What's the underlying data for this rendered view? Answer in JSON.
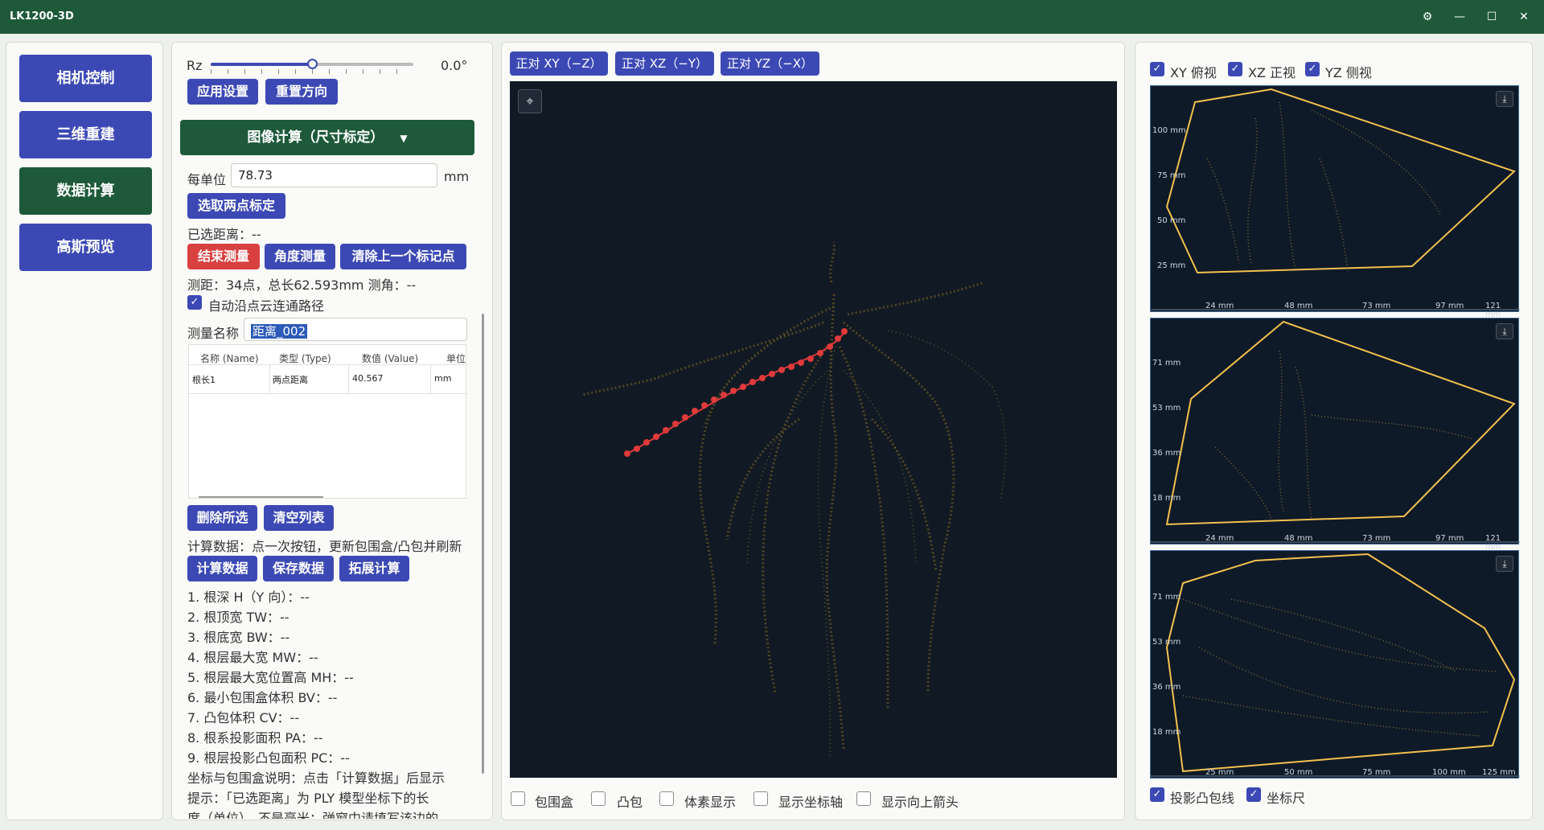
{
  "app_title": "LK1200-3D",
  "nav": [
    {
      "label": "相机控制"
    },
    {
      "label": "三维重建"
    },
    {
      "label": "数据计算"
    },
    {
      "label": "高斯预览"
    }
  ],
  "rotation": {
    "label": "Rz",
    "value": "0.0°",
    "apply_label": "应用设置",
    "reset_label": "重置方向"
  },
  "section_header": "图像计算（尺寸标定）",
  "unit": {
    "label": "每单位",
    "value": "78.73",
    "suffix": "mm"
  },
  "pick_two_points_label": "选取两点标定",
  "selected_distance": "已选距离：--",
  "measure_buttons": {
    "end": "结束测量",
    "angle": "角度测量",
    "clear_last": "清除上一个标记点"
  },
  "measure_status": "测距：34点，总长62.593mm 测角：--",
  "auto_path": {
    "label": "自动沿点云连通路径",
    "checked": true
  },
  "measure_name": {
    "label": "测量名称",
    "value": "距离_002"
  },
  "table": {
    "headers": [
      "名称 (Name)",
      "类型 (Type)",
      "数值 (Value)",
      "单位"
    ],
    "rows": [
      [
        "根长1",
        "两点距离",
        "40.567",
        "mm"
      ]
    ]
  },
  "list_buttons": {
    "delete": "删除所选",
    "clear": "清空列表"
  },
  "compute_hint": "计算数据：点一次按钮，更新包围盒/凸包并刷新",
  "compute_buttons": {
    "compute": "计算数据",
    "save": "保存数据",
    "extend": "拓展计算"
  },
  "results": [
    "1. 根深 H（Y 向）：--",
    "2. 根顶宽 TW：--",
    "3. 根底宽 BW：--",
    "4. 根层最大宽 MW：--",
    "5. 根层最大宽位置高 MH：--",
    "6. 最小包围盒体积 BV：--",
    "7. 凸包体积 CV：--",
    "8. 根系投影面积 PA：--",
    "9. 根层投影凸包面积 PC：--"
  ],
  "notes": [
    "坐标与包围盒说明：点击「计算数据」后显示",
    "提示：「已选距离」为 PLY 模型坐标下的长",
    "度（单位）。不是毫米；弹窗中请填写该边的"
  ],
  "view_buttons": [
    "正对 XY（−Z）",
    "正对 XZ（−Y）",
    "正对 YZ（−X）"
  ],
  "bottom_checks": [
    {
      "label": "包围盒",
      "checked": false
    },
    {
      "label": "凸包",
      "checked": false
    },
    {
      "label": "体素显示",
      "checked": false
    },
    {
      "label": "显示坐标轴",
      "checked": false
    },
    {
      "label": "显示向上箭头",
      "checked": false
    }
  ],
  "proj_checks": [
    {
      "label": "XY 俯视",
      "checked": true
    },
    {
      "label": "XZ 正视",
      "checked": true
    },
    {
      "label": "YZ 侧视",
      "checked": true
    }
  ],
  "proj_bottom_checks": [
    {
      "label": "投影凸包线",
      "checked": true
    },
    {
      "label": "坐标尺",
      "checked": true
    }
  ],
  "projections": [
    {
      "y_ticks": [
        "100 mm",
        "75 mm",
        "50 mm",
        "25 mm"
      ],
      "x_ticks": [
        "24 mm",
        "48 mm",
        "73 mm",
        "97 mm",
        "121 mm"
      ]
    },
    {
      "y_ticks": [
        "71 mm",
        "53 mm",
        "36 mm",
        "18 mm"
      ],
      "x_ticks": [
        "24 mm",
        "48 mm",
        "73 mm",
        "97 mm",
        "121 mm"
      ]
    },
    {
      "y_ticks": [
        "71 mm",
        "53 mm",
        "36 mm",
        "18 mm"
      ],
      "x_ticks": [
        "25 mm",
        "50 mm",
        "75 mm",
        "100 mm",
        "125 mm"
      ]
    }
  ],
  "colors": {
    "accent": "#3c49b5",
    "brand_green": "#1e5a3a",
    "danger": "#d94040",
    "hull": "#f2c14e"
  }
}
